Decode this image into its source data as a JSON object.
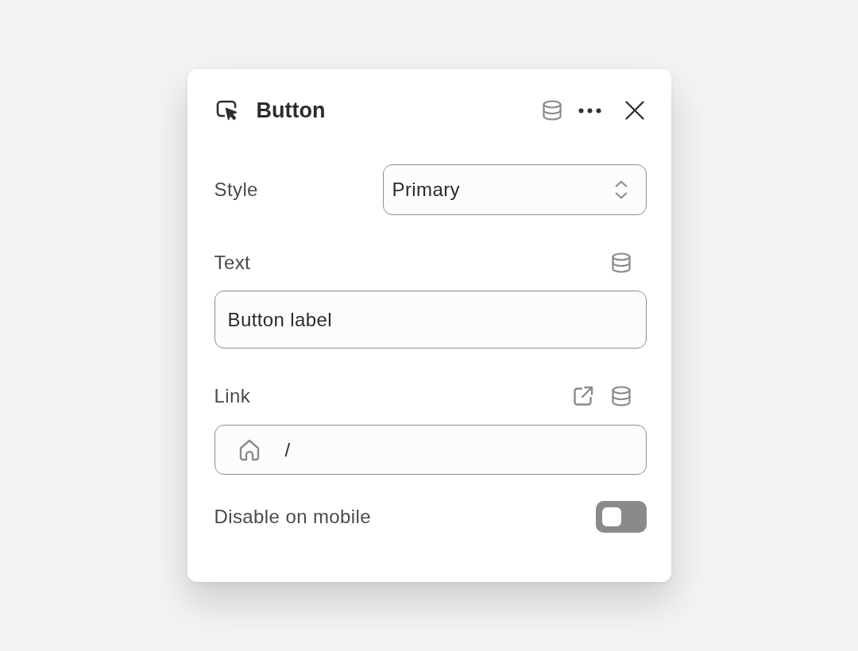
{
  "panel": {
    "title": "Button"
  },
  "fields": [
    {
      "kind": "select",
      "label": "Style",
      "value": "Primary"
    },
    {
      "kind": "text",
      "label": "Text",
      "value": "Button label"
    },
    {
      "kind": "link",
      "label": "Link",
      "value": "/"
    },
    {
      "kind": "toggle",
      "label": "Disable on mobile",
      "on": false
    }
  ]
}
